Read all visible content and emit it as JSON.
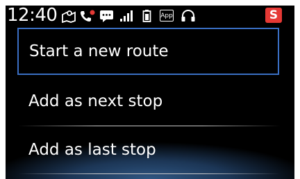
{
  "status_bar": {
    "time": "12:40",
    "icons": [
      "map-pin-icon",
      "phone-icon",
      "message-icon",
      "signal-icon",
      "battery-icon",
      "app-icon",
      "headset-icon"
    ],
    "app_label": "App",
    "s_label": "S",
    "s_color": "#e53935"
  },
  "menu": {
    "items": [
      {
        "label": "Start a new route",
        "selected": true
      },
      {
        "label": "Add as next stop",
        "selected": false
      },
      {
        "label": "Add as last stop",
        "selected": false
      }
    ]
  },
  "colors": {
    "selection_border": "#3a6fc4",
    "background": "#000000",
    "glow": "#2f5682"
  }
}
